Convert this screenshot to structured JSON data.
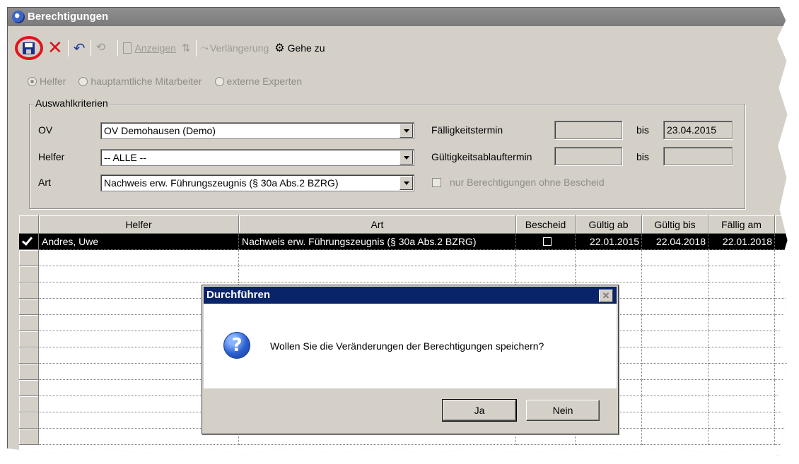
{
  "window": {
    "title": "Berechtigungen"
  },
  "toolbar": {
    "anzeigen_label": "Anzeigen",
    "verlaengerung_label": "Verlängerung",
    "gehe_zu_label": "Gehe zu"
  },
  "radio_options": [
    {
      "label": "Helfer",
      "selected": true
    },
    {
      "label": "hauptamtliche Mitarbeiter",
      "selected": false
    },
    {
      "label": "externe Experten",
      "selected": false
    }
  ],
  "criteria": {
    "legend": "Auswahlkriterien",
    "ov_label": "OV",
    "ov_value": "OV Demohausen (Demo)",
    "helfer_label": "Helfer",
    "helfer_value": "-- ALLE --",
    "art_label": "Art",
    "art_value": "Nachweis erw. Führungszeugnis (§ 30a Abs.2 BZRG)",
    "faelligkeit_label": "Fälligkeitstermin",
    "faelligkeit_from": "",
    "bis_label": "bis",
    "faelligkeit_to": "23.04.2015",
    "gueltigkeit_label": "Gültigkeitsablauftermin",
    "gueltigkeit_from": "",
    "gueltigkeit_to": "",
    "ohne_bescheid_label": "nur Berechtigungen ohne Bescheid"
  },
  "table": {
    "columns": [
      "Helfer",
      "Art",
      "Bescheid",
      "Gültig ab",
      "Gültig bis",
      "Fällig am"
    ],
    "rows": [
      [
        "Andres, Uwe",
        "Nachweis erw. Führungszeugnis (§ 30a Abs.2 BZRG)",
        "",
        "22.01.2015",
        "22.04.2018",
        "22.01.2018"
      ]
    ]
  },
  "dialog": {
    "title": "Durchführen",
    "message": "Wollen Sie die Veränderungen der Berechtigungen speichern?",
    "yes_label": "Ja",
    "no_label": "Nein"
  }
}
